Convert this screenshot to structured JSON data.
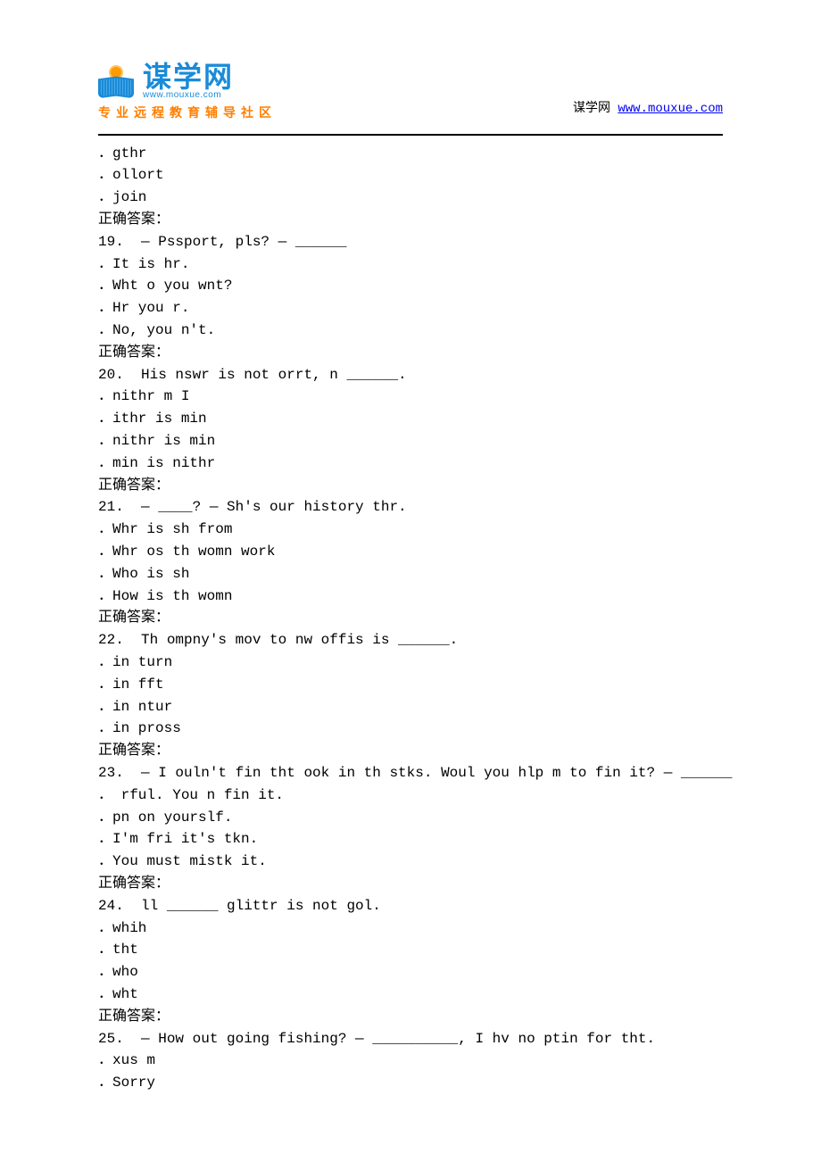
{
  "header": {
    "brand_cn": "谋学网",
    "brand_url": "www.mouxue.com",
    "tagline": "专业远程教育辅导社区",
    "right_label": "谋学网",
    "right_link": "www.mouxue.com"
  },
  "lines": [
    "．gthr",
    "．ollort",
    "．join",
    "正确答案：",
    "19.  — Pssport, pls? — ______",
    "．It is hr.",
    "．Wht o you wnt?",
    "．Hr you r.",
    "．No, you n't.",
    "正确答案：",
    "20.  His nswr is not orrt, n ______.",
    "．nithr m I",
    "．ithr is min",
    "．nithr is min",
    "．min is nithr",
    "正确答案：",
    "21.  — ____? — Sh's our history thr.",
    "．Whr is sh from",
    "．Whr os th womn work",
    "．Who is sh",
    "．How is th womn",
    "正确答案：",
    "22.  Th ompny's mov to nw offis is ______.",
    "．in turn",
    "．in fft",
    "．in ntur",
    "．in pross",
    "正确答案：",
    "23.  — I ouln't fin tht ook in th stks. Woul you hlp m to fin it? — ______",
    "． rful. You n fin it.",
    "．pn on yourslf.",
    "．I'm fri it's tkn.",
    "．You must mistk it.",
    "正确答案：",
    "24.  ll ______ glittr is not gol.",
    "．whih",
    "．tht",
    "．who",
    "．wht",
    "正确答案：",
    "25.  — How out going fishing? — __________, I hv no ptin for tht.",
    "．xus m",
    "．Sorry"
  ]
}
